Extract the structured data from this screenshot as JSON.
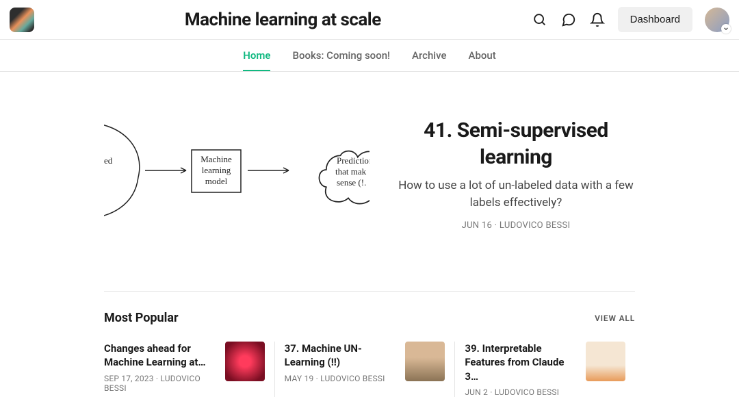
{
  "header": {
    "title": "Machine learning at scale",
    "dashboard": "Dashboard"
  },
  "nav": {
    "home": "Home",
    "books": "Books: Coming soon!",
    "archive": "Archive",
    "about": "About"
  },
  "featured": {
    "title": "41. Semi-supervised learning",
    "subtitle": "How to use a lot of un-labeled data with a few labels effectively?",
    "date": "JUN 16",
    "author": "LUDOVICO BESSI",
    "diagram": {
      "node1": "ed",
      "node2a": "Machine",
      "node2b": "learning",
      "node2c": "model",
      "node3a": "Prediction",
      "node3b": "that mak",
      "node3c": "sense (!."
    }
  },
  "popular": {
    "heading": "Most Popular",
    "view_all": "VIEW ALL",
    "items": [
      {
        "title": "Changes ahead for Machine Learning at…",
        "date": "SEP 17, 2023",
        "author": "LUDOVICO BESSI"
      },
      {
        "title": "37. Machine UN-Learning (!!)",
        "date": "MAY 19",
        "author": "LUDOVICO BESSI"
      },
      {
        "title": "39. Interpretable Features from Claude 3…",
        "date": "JUN 2",
        "author": "LUDOVICO BESSI"
      }
    ]
  }
}
